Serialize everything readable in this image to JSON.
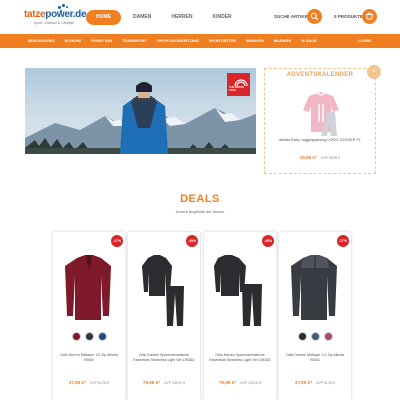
{
  "brand": {
    "name_left": "tatze",
    "name_right": "power.de",
    "tagline": "Sport, Outdoor & Lifestyle"
  },
  "nav": {
    "items": [
      "Home",
      "Damen",
      "Herren",
      "Kinder"
    ]
  },
  "search": {
    "label": "SUCHE ARTIKEL"
  },
  "cart": {
    "label": "0 PRODUKTE"
  },
  "categories": [
    "BEKLEIDUNG",
    "SCHUHE",
    "FUNKTION",
    "TEAMSPORT",
    "SPORTAUSRÜSTUNG",
    "SPORTARTEN",
    "MARKEN",
    "MARKEN",
    "% SALE"
  ],
  "login": "LOGIN",
  "hero": {
    "logo_text": "THE NORTH FACE"
  },
  "advent": {
    "title": "ADVENTSKALENDER",
    "close": "×",
    "product": "adidas Baby Joggingsanzug LOGO JOGGER FL",
    "price": "29,96 €*",
    "uvp": "UVP 39,95 €"
  },
  "deals": {
    "title": "DEALS",
    "subtitle": "Unsere Angebote der Woche"
  },
  "products": [
    {
      "badge": "-27%",
      "name": "Odlo Herren Midlayer 1/2 Zip Alliuda 90080",
      "price": "37,95 €*",
      "uvp": "UVP 52,00 €",
      "colors": [
        "#7e1a2a",
        "#2b3a4b",
        "#234b8a"
      ]
    },
    {
      "badge": "-40%",
      "name": "Odlo Damen Sportunterwäsche Essentials Seamless Light Set 196362",
      "price": "79,96 €*",
      "uvp": "UVP 130,00 €",
      "colors": []
    },
    {
      "badge": "-40%",
      "name": "Odlo Herren Sportunterwäsche Essentials Seamless Light Set 196362",
      "price": "79,96 €*",
      "uvp": "UVP 130,00 €",
      "colors": []
    },
    {
      "badge": "-27%",
      "name": "Odlo Damen Midlayer 1/2 Zip Alliuda 90081",
      "price": "37,95 €*",
      "uvp": "UVP 52,00 €",
      "colors": [
        "#2c2c34",
        "#3a5d78",
        "#b0486a"
      ]
    }
  ],
  "colors": {
    "accent": "#f07f22",
    "badge": "#d8262b"
  }
}
